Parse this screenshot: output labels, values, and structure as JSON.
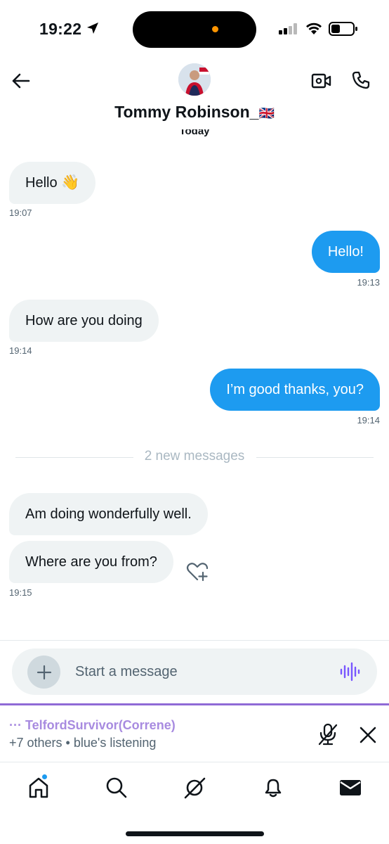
{
  "status": {
    "time": "19:22"
  },
  "header": {
    "name": "Tommy Robinson_",
    "flag": "🇬🇧",
    "date_label": "Today"
  },
  "messages": [
    {
      "direction": "in",
      "text": "Hello",
      "emoji": "👋",
      "time": "19:07"
    },
    {
      "direction": "out",
      "text": "Hello!",
      "time": "19:13"
    },
    {
      "direction": "in",
      "text": "How are you doing",
      "time": "19:14"
    },
    {
      "direction": "out",
      "text": "I’m good thanks, you?",
      "time": "19:14"
    },
    {
      "direction": "in",
      "text": "Am doing wonderfully well.",
      "time": ""
    },
    {
      "direction": "in",
      "text": "Where are you from?",
      "time": "19:15"
    }
  ],
  "divider": {
    "label": "2 new messages"
  },
  "composer": {
    "placeholder": "Start a message"
  },
  "space": {
    "prefix": "···",
    "host": "TelfordSurvivor(Correne)",
    "listeners": "+7 others • blue's listening"
  },
  "nav": {
    "items": [
      "home-icon",
      "search-icon",
      "grok-icon",
      "bell-icon",
      "mail-icon"
    ]
  },
  "colors": {
    "accent": "#1d9bf0",
    "space": "#8f6ad6",
    "bubble_in": "#eff3f4"
  }
}
